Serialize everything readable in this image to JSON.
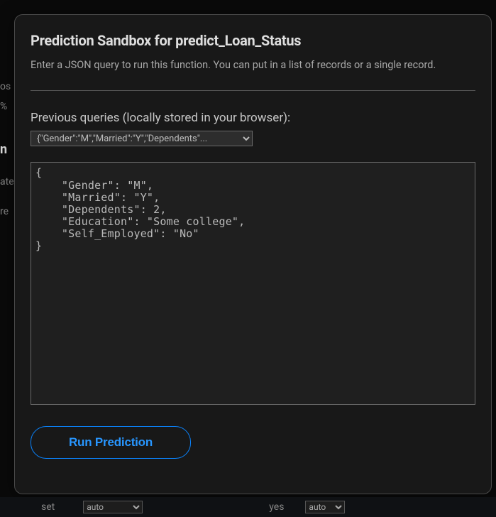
{
  "background": {
    "frag_os": "os",
    "frag_pct": "%",
    "frag_n": "n",
    "frag_ate": "ate",
    "frag_re": "re"
  },
  "modal": {
    "title": "Prediction Sandbox for predict_Loan_Status",
    "subtitle": "Enter a JSON query to run this function. You can put in a list of records or a single record.",
    "previous_label": "Previous queries (locally stored in your browser):",
    "previous_select_display": "{\"Gender\":\"M\",\"Married\":\"Y\",\"Dependents\"...",
    "json_value": "{\n    \"Gender\": \"M\",\n    \"Married\": \"Y\",\n    \"Dependents\": 2,\n    \"Education\": \"Some college\",\n    \"Self_Employed\": \"No\"\n}",
    "run_label": "Run Prediction"
  },
  "bottom": {
    "label_set": "set",
    "select1_value": "auto",
    "label_yes": "yes",
    "select2_value": "auto"
  }
}
